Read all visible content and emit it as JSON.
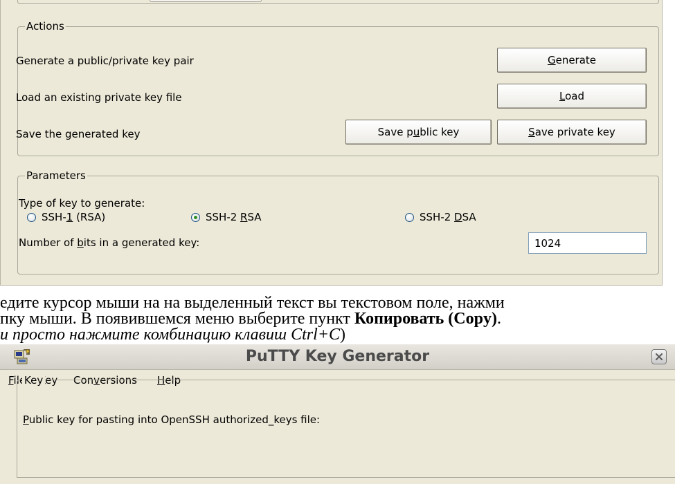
{
  "top_dialog": {
    "actions": {
      "legend": "Actions",
      "rows": [
        {
          "label": "Generate a public/private key pair"
        },
        {
          "label": "Load an existing private key file"
        },
        {
          "label": "Save the generated key"
        }
      ],
      "generate_button": {
        "pre": "",
        "u": "G",
        "post": "enerate"
      },
      "load_button": {
        "pre": "",
        "u": "L",
        "post": "oad"
      },
      "save_public_button": {
        "pre": "Save p",
        "u": "u",
        "post": "blic key"
      },
      "save_private_button": {
        "pre": "",
        "u": "S",
        "post": "ave private key"
      }
    },
    "parameters": {
      "legend": "Parameters",
      "type_label": "Type of key to generate:",
      "options": [
        {
          "pre": "SSH-",
          "u": "1",
          "post": " (RSA)",
          "selected": false
        },
        {
          "pre": "SSH-2 ",
          "u": "R",
          "post": "SA",
          "selected": true
        },
        {
          "pre": "SSH-2 ",
          "u": "D",
          "post": "SA",
          "selected": false
        }
      ],
      "bits_label": {
        "pre": "Number of ",
        "u": "b",
        "post": "its in a generated key:"
      },
      "bits_value": "1024"
    }
  },
  "instruction": {
    "line1": "едите  курсор мыши на на выделенный текст вы текстовом поле, нажми",
    "line2_pre": "пку мыши. В появившемся меню выберите пункт ",
    "line2_bold": "Копировать (Copy)",
    "line2_post": ".",
    "line3_italic": "и просто нажмите комбинацию клавиш Ctrl+C",
    "line3_post": ")"
  },
  "putty_window": {
    "title": "PuTTY Key Generator",
    "menu": [
      {
        "pre": "",
        "u": "F",
        "post": "ile"
      },
      {
        "pre": "",
        "u": "K",
        "post": "ey"
      },
      {
        "pre": "Con",
        "u": "v",
        "post": "ersions"
      },
      {
        "pre": "",
        "u": "H",
        "post": "elp"
      }
    ],
    "key_group_legend": "Key",
    "public_key_label": {
      "pre": "",
      "u": "P",
      "post": "ublic key for pasting into OpenSSH authorized_keys file:"
    }
  },
  "icons": {
    "app": "putty-keygen-icon",
    "close": "close-icon",
    "radio": "radio-icon"
  }
}
